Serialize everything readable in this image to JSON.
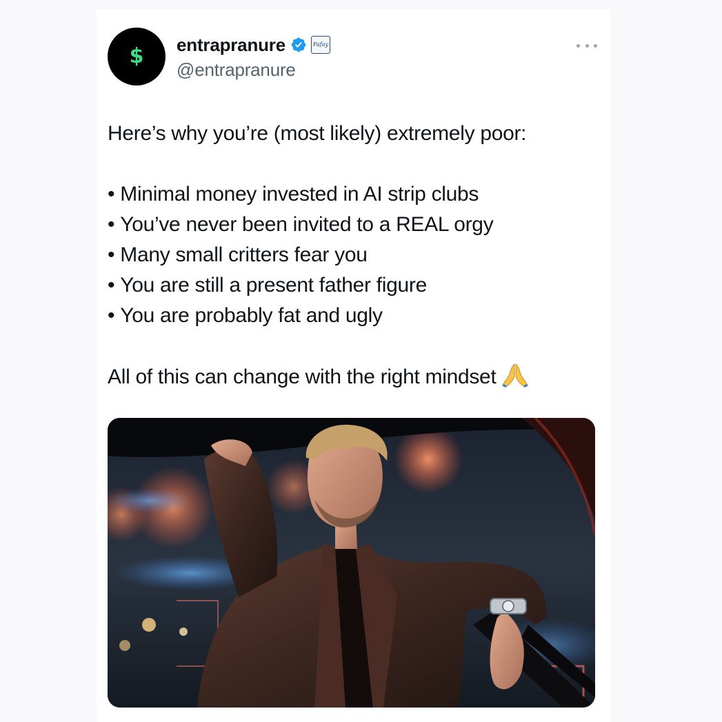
{
  "tweet": {
    "author": {
      "display_name": "entrapranure",
      "handle": "@entrapranure",
      "avatar_glyph": "$",
      "verified": true,
      "affiliate_badge_text": "Fafay"
    },
    "text": {
      "intro": "Here’s why you’re (most likely) extremely poor:",
      "bullets": [
        "Minimal money invested in AI strip clubs",
        "You’ve never been invited to a REAL orgy",
        "Many small critters fear you",
        "You are still a present father figure",
        "You are probably fat and ugly"
      ],
      "closing": "All of this can change with the right mindset",
      "closing_emoji": "pray-icon"
    },
    "media": {
      "type": "photo",
      "icon": "photo-man-in-leather-jacket-night-city"
    }
  },
  "colors": {
    "background": "#f9f9fc",
    "card": "#ffffff",
    "text_primary": "#0f1419",
    "text_secondary": "#536471",
    "verified_blue": "#1d9bf0",
    "avatar_bg": "#000000",
    "avatar_glyph": "#3ddc84"
  }
}
